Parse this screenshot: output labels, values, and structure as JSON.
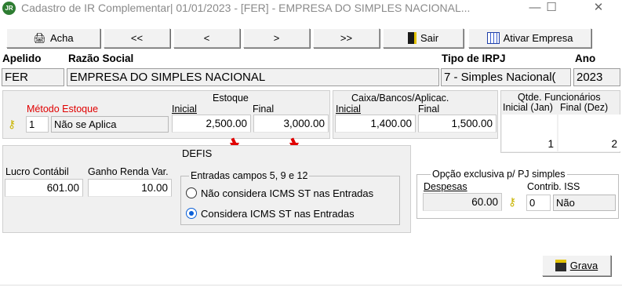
{
  "window": {
    "app_icon": "JR",
    "title": "Cadastro de IR Complementar|  01/01/2023 - [FER] - EMPRESA DO SIMPLES NACIONAL...",
    "minimize": "—",
    "maximize": "☐",
    "close": "✕"
  },
  "toolbar": {
    "acha": "Acha",
    "first": "<<",
    "prev": "<",
    "next": ">",
    "last": ">>",
    "sair": "Sair",
    "ativar": "Ativar Empresa"
  },
  "header": {
    "apelido_label": "Apelido",
    "razao_label": "Razão Social",
    "tipo_label": "Tipo de IRPJ",
    "ano_label": "Ano",
    "apelido": "FER",
    "razao": "EMPRESA DO SIMPLES NACIONAL",
    "tipo": "7 - Simples Nacional(",
    "ano": "2023"
  },
  "estoque": {
    "metodo_label": "Método Estoque",
    "metodo_code": "1",
    "metodo_desc": "Não se Aplica",
    "title": "Estoque",
    "inicial_label": "Inicial",
    "final_label": "Final",
    "inicial": "2,500.00",
    "final": "3,000.00"
  },
  "caixa": {
    "title": "Caixa/Bancos/Aplicac.",
    "inicial_label": "Inicial",
    "final_label": "Final",
    "inicial": "1,400.00",
    "final": "1,500.00"
  },
  "funcionarios": {
    "title": "Qtde. Funcionários",
    "inicial_label": "Inicial (Jan)",
    "final_label": "Final (Dez)",
    "inicial": "1",
    "final": "2"
  },
  "defis": {
    "title": "DEFIS",
    "lucro_label": "Lucro Contábil",
    "ganho_label": "Ganho Renda Var.",
    "lucro": "601.00",
    "ganho": "10.00",
    "entradas_legend": "Entradas campos 5, 9 e 12",
    "option1": "Não considera ICMS ST nas Entradas",
    "option2": "Considera ICMS ST nas Entradas"
  },
  "opcao": {
    "legend": "Opção exclusiva p/ PJ simples",
    "despesas_label": "Despesas",
    "contrib_label": "Contrib. ISS",
    "despesas": "60.00",
    "contrib_code": "0",
    "contrib_desc": "Não"
  },
  "grava": "Grava",
  "colors": {
    "required_label": "#e00000",
    "arrow": "#e00000",
    "radio_selected": "#0a5fd7"
  }
}
